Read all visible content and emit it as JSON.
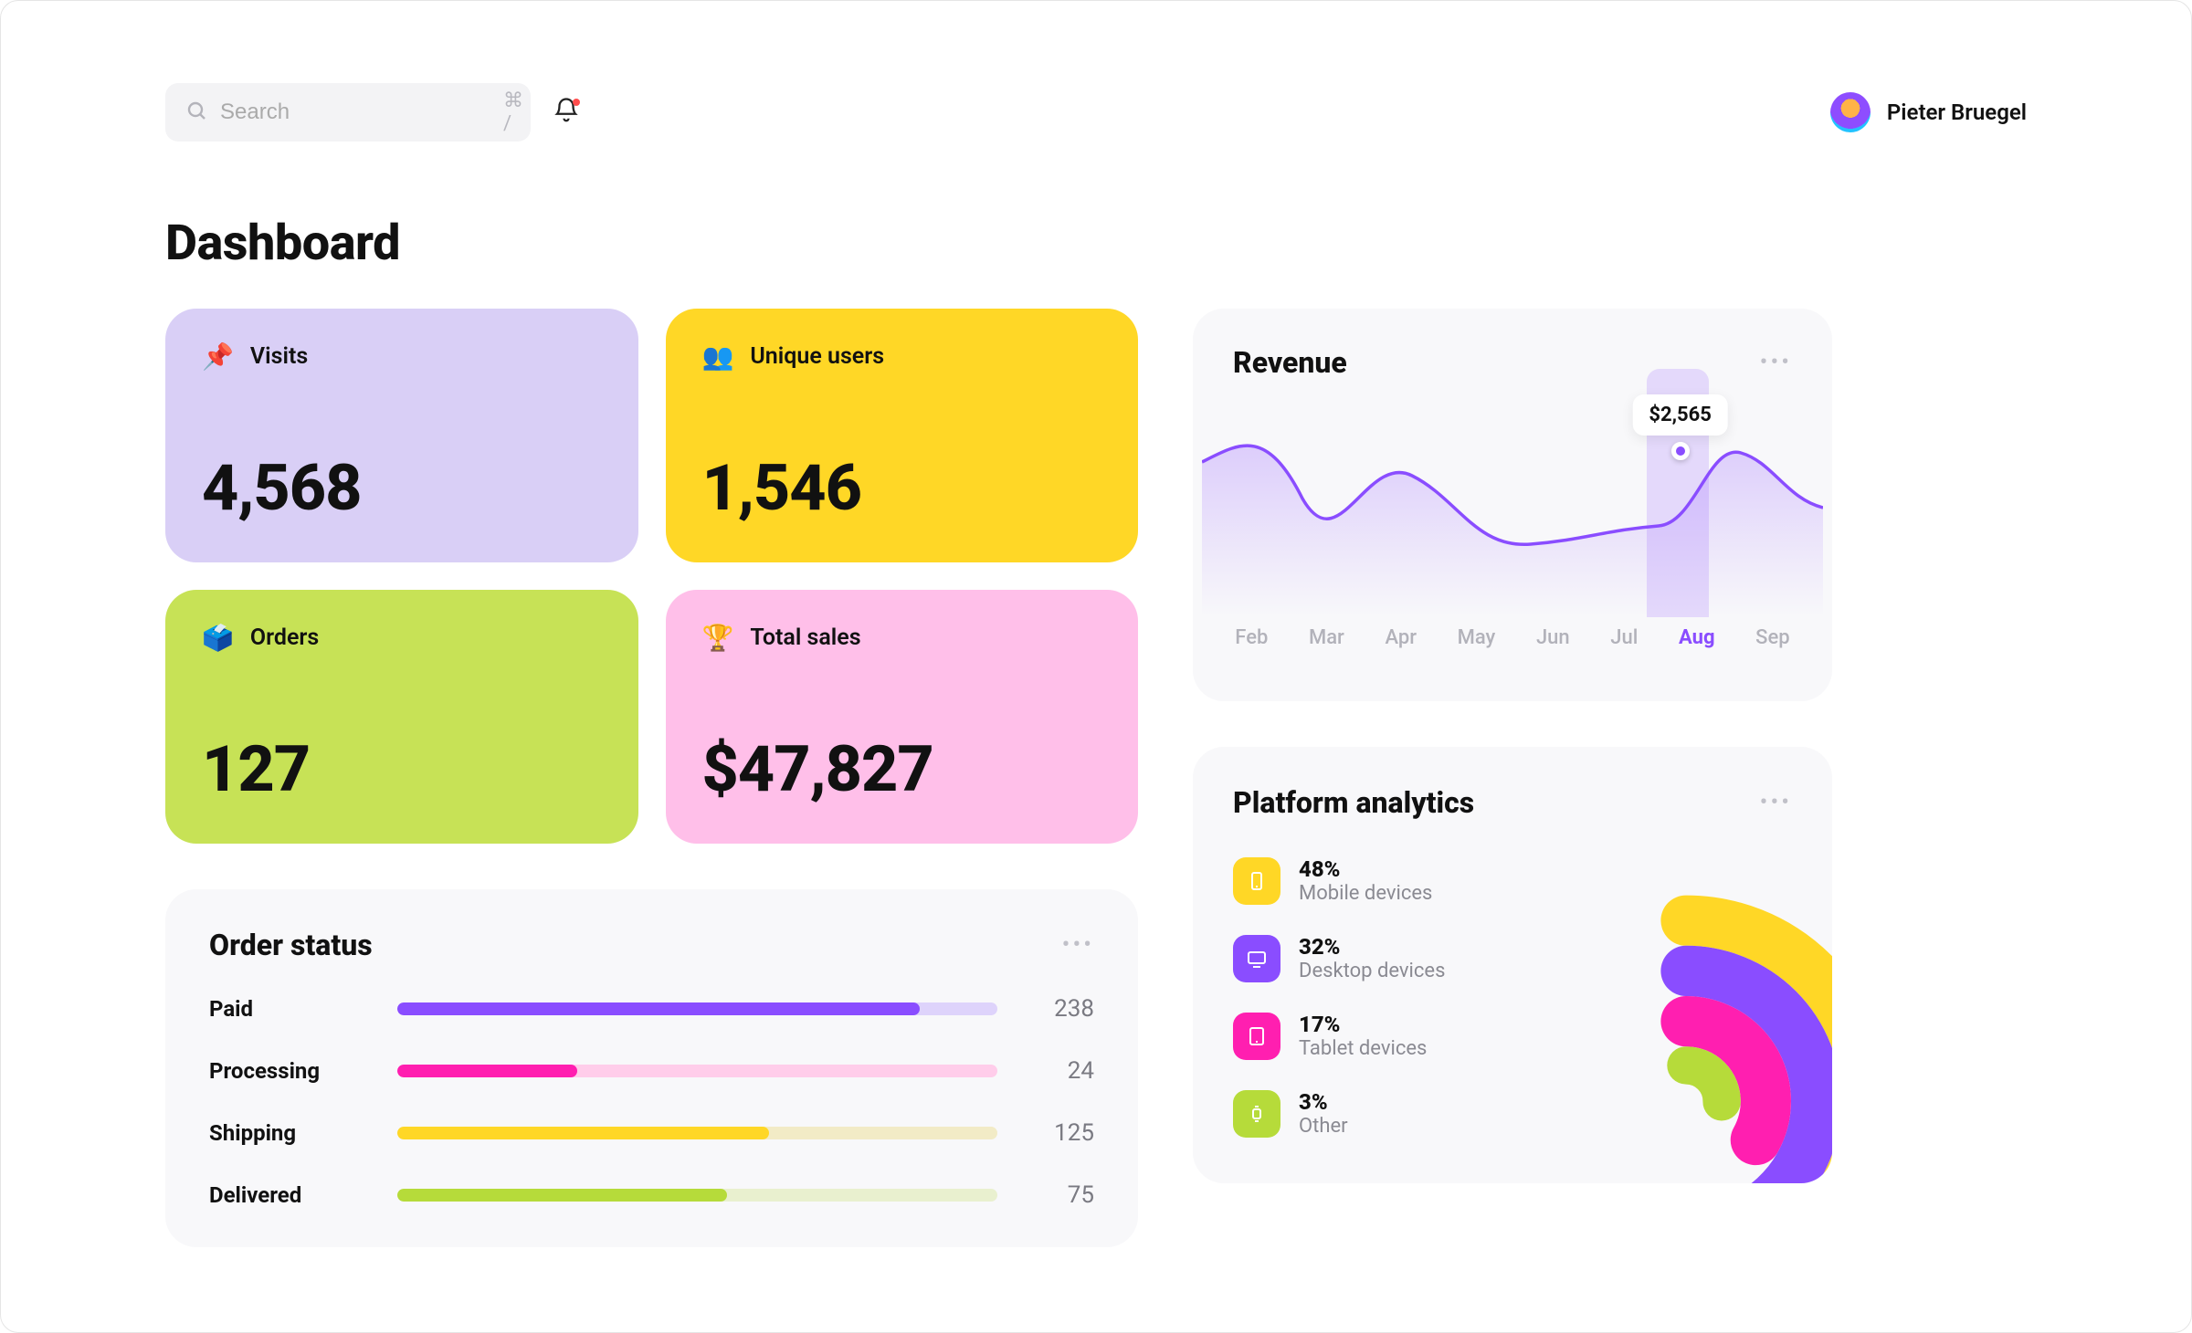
{
  "header": {
    "search_placeholder": "Search",
    "shortcut": "⌘ /",
    "user_name": "Pieter Bruegel"
  },
  "page": {
    "title": "Dashboard"
  },
  "stats": [
    {
      "key": "visits",
      "label": "Visits",
      "value": "4,568",
      "emoji": "📌",
      "bg": "c-violet"
    },
    {
      "key": "unique_users",
      "label": "Unique users",
      "value": "1,546",
      "emoji": "👥",
      "bg": "c-yellow"
    },
    {
      "key": "orders",
      "label": "Orders",
      "value": "127",
      "emoji": "🗳️",
      "bg": "c-lime"
    },
    {
      "key": "total_sales",
      "label": "Total sales",
      "value": "$47,827",
      "emoji": "🏆",
      "bg": "c-pink"
    }
  ],
  "order_status": {
    "title": "Order status",
    "rows": [
      {
        "label": "Paid",
        "count": "238",
        "pct": 87,
        "fill": "#8a4dff",
        "track": "#ded3fb"
      },
      {
        "label": "Processing",
        "count": "24",
        "pct": 30,
        "fill": "#ff1fb0",
        "track": "#ffcdea"
      },
      {
        "label": "Shipping",
        "count": "125",
        "pct": 62,
        "fill": "#ffd726",
        "track": "#f2ebc6"
      },
      {
        "label": "Delivered",
        "count": "75",
        "pct": 55,
        "fill": "#b6db3a",
        "track": "#e9f0cf"
      }
    ]
  },
  "revenue": {
    "title": "Revenue",
    "tooltip": "$2,565",
    "months": [
      "Feb",
      "Mar",
      "Apr",
      "May",
      "Jun",
      "Jul",
      "Aug",
      "Sep"
    ],
    "active_month": "Aug"
  },
  "platform": {
    "title": "Platform analytics",
    "items": [
      {
        "pct": "48%",
        "label": "Mobile devices",
        "color": "#ffd726",
        "icon": "mobile"
      },
      {
        "pct": "32%",
        "label": "Desktop devices",
        "color": "#8a4dff",
        "icon": "desktop"
      },
      {
        "pct": "17%",
        "label": "Tablet devices",
        "color": "#ff1fb0",
        "icon": "tablet"
      },
      {
        "pct": "3%",
        "label": "Other",
        "color": "#b6db3a",
        "icon": "watch"
      }
    ]
  },
  "chart_data": [
    {
      "type": "line",
      "title": "Revenue",
      "x": [
        "Feb",
        "Mar",
        "Apr",
        "May",
        "Jun",
        "Jul",
        "Aug",
        "Sep"
      ],
      "values_relative": [
        0.7,
        0.35,
        0.72,
        0.45,
        0.58,
        0.5,
        0.8,
        0.55
      ],
      "highlight": {
        "x": "Aug",
        "value": 2565,
        "display": "$2,565"
      },
      "xlabel": "",
      "ylabel": ""
    },
    {
      "type": "bar",
      "title": "Order status",
      "categories": [
        "Paid",
        "Processing",
        "Shipping",
        "Delivered"
      ],
      "values": [
        238,
        24,
        125,
        75
      ]
    },
    {
      "type": "pie",
      "title": "Platform analytics",
      "slices": [
        {
          "label": "Mobile devices",
          "pct": 48,
          "color": "#ffd726"
        },
        {
          "label": "Desktop devices",
          "pct": 32,
          "color": "#8a4dff"
        },
        {
          "label": "Tablet devices",
          "pct": 17,
          "color": "#ff1fb0"
        },
        {
          "label": "Other",
          "pct": 3,
          "color": "#b6db3a"
        }
      ]
    }
  ]
}
